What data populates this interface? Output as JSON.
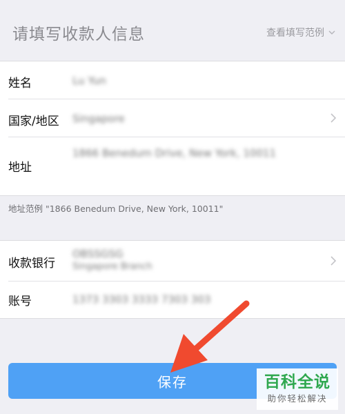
{
  "header": {
    "title": "请填写收款人信息",
    "example_link": "查看填写范例"
  },
  "form": {
    "personal": {
      "name": {
        "label": "姓名",
        "value": "Lu Yun"
      },
      "country": {
        "label": "国家/地区",
        "value": "Singapore"
      },
      "address": {
        "label": "地址",
        "value": "1866 Benedum Drive, New York, 10011"
      }
    },
    "address_hint": "地址范例 \"1866 Benedum Drive, New York, 10011\"",
    "bank": {
      "bank": {
        "label": "收款银行",
        "value": "OBSSGSG",
        "value_line2": "Singapore Branch"
      },
      "account": {
        "label": "账号",
        "value": "1373 3303 3333 7303 303"
      }
    }
  },
  "save_button": "保存",
  "watermark": {
    "main": "百科全说",
    "sub": "助你轻松解决"
  },
  "colors": {
    "background": "#efeff4",
    "button": "#4fa1f5",
    "arrow": "#f04a2f",
    "watermark": "#2fa84f"
  }
}
